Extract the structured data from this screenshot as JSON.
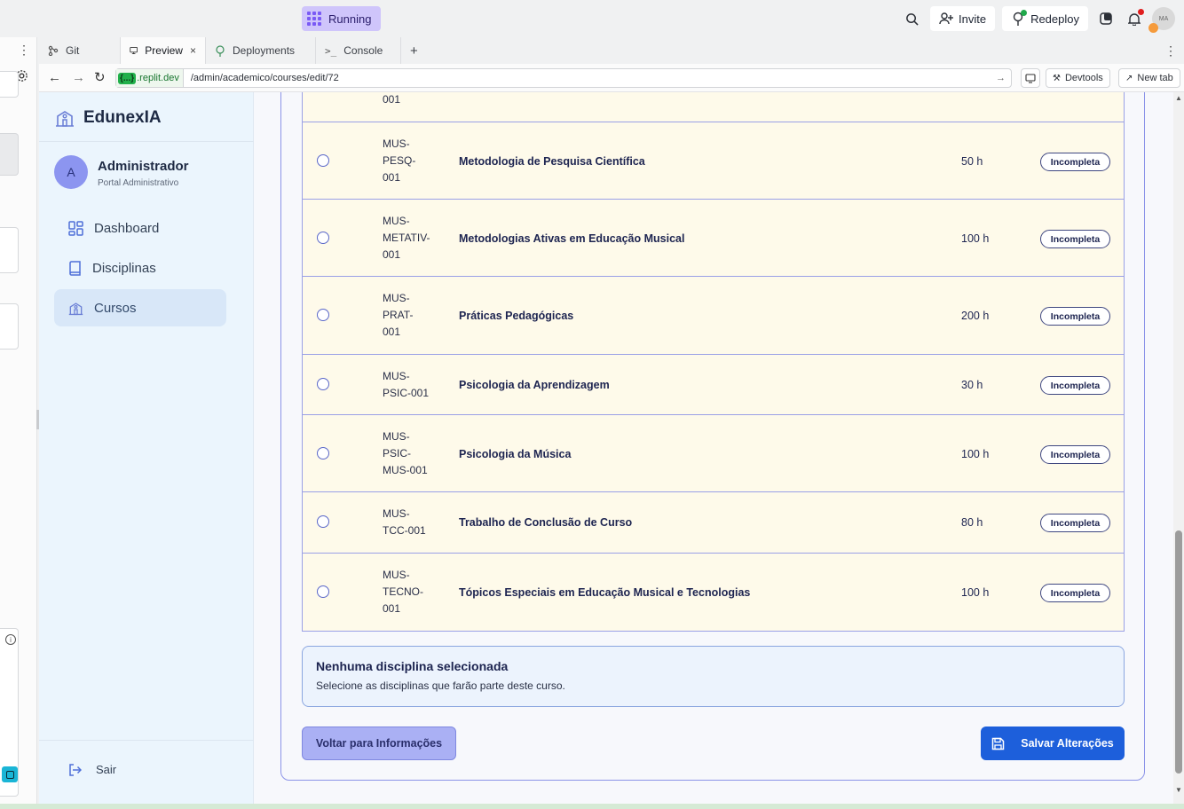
{
  "ide": {
    "status_label": "Running",
    "invite_label": "Invite",
    "redeploy_label": "Redeploy",
    "avatar_initials": "MA",
    "tabs": [
      {
        "label": "Git",
        "icon": "git-icon"
      },
      {
        "label": "Preview",
        "icon": "preview-icon",
        "closable": "×"
      },
      {
        "label": "Deployments",
        "icon": "deployments-icon"
      },
      {
        "label": "Console",
        "icon": "console-icon"
      }
    ],
    "add_tab": "+",
    "menu_dots": "⋮",
    "url_badge": "{...}",
    "url_domain": ".replit.dev",
    "url_path": "/admin/academico/courses/edit/72",
    "devtools_label": "Devtools",
    "newtab_label": "New tab"
  },
  "sidebar": {
    "brand": "EdunexIA",
    "user_initial": "A",
    "user_name": "Administrador",
    "user_role": "Portal Administrativo",
    "nav": [
      {
        "label": "Dashboard",
        "icon": "dashboard-icon",
        "active": false
      },
      {
        "label": "Disciplinas",
        "icon": "book-icon",
        "active": false
      },
      {
        "label": "Cursos",
        "icon": "school-icon",
        "active": true
      }
    ],
    "logout_label": "Sair"
  },
  "disciplines": [
    {
      "code": [
        "001"
      ],
      "name": "",
      "hours": "",
      "status": ""
    },
    {
      "code": [
        "MUS-",
        "PESQ-",
        "001"
      ],
      "name": "Metodologia de Pesquisa Científica",
      "hours": "50 h",
      "status": "Incompleta"
    },
    {
      "code": [
        "MUS-",
        "METATIV-",
        "001"
      ],
      "name": "Metodologias Ativas em Educação Musical",
      "hours": "100 h",
      "status": "Incompleta"
    },
    {
      "code": [
        "MUS-",
        "PRAT-",
        "001"
      ],
      "name": "Práticas Pedagógicas",
      "hours": "200 h",
      "status": "Incompleta"
    },
    {
      "code": [
        "MUS-",
        "PSIC-001"
      ],
      "name": "Psicologia da Aprendizagem",
      "hours": "30 h",
      "status": "Incompleta"
    },
    {
      "code": [
        "MUS-",
        "PSIC-",
        "MUS-001"
      ],
      "name": "Psicologia da Música",
      "hours": "100 h",
      "status": "Incompleta"
    },
    {
      "code": [
        "MUS-",
        "TCC-001"
      ],
      "name": "Trabalho de Conclusão de Curso",
      "hours": "80 h",
      "status": "Incompleta"
    },
    {
      "code": [
        "MUS-",
        "TECNO-",
        "001"
      ],
      "name": "Tópicos Especiais em Educação Musical e Tecnologias",
      "hours": "100 h",
      "status": "Incompleta"
    }
  ],
  "selection_info": {
    "title": "Nenhuma disciplina selecionada",
    "text": "Selecione as disciplinas que farão parte deste curso."
  },
  "actions": {
    "back_label": "Voltar para Informações",
    "save_label": "Salvar Alterações"
  }
}
